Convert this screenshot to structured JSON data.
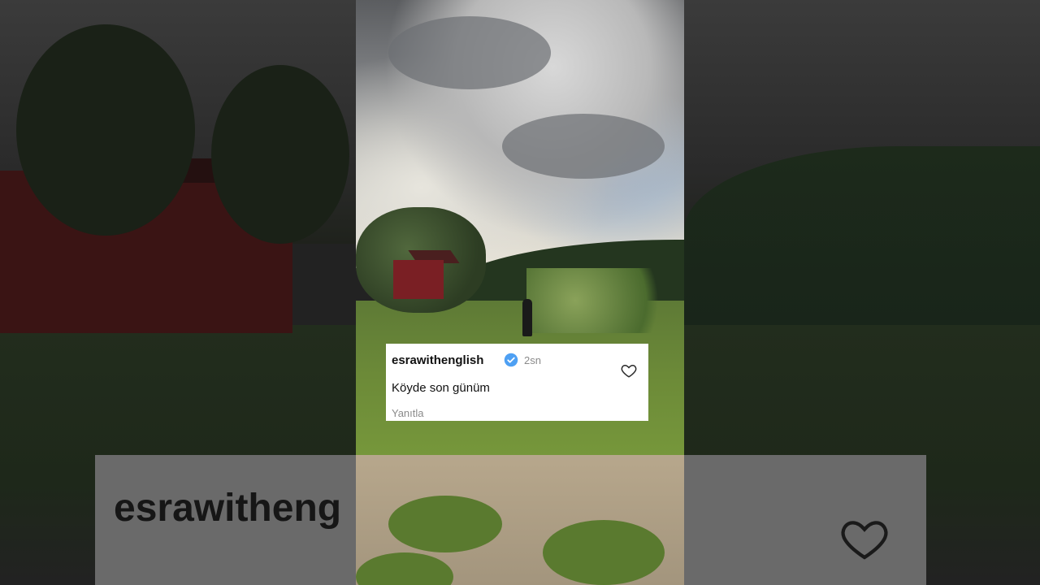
{
  "comment_card": {
    "username": "esrawithenglish",
    "verified_icon": "verified-badge-icon",
    "timestamp": "2sn",
    "text": "Köyde son günüm",
    "reply_label": "Yanıtla",
    "like_icon": "heart-outline-icon"
  },
  "backdrop": {
    "name_text": "esrawitheng",
    "like_icon": "heart-outline-icon"
  },
  "colors": {
    "card_bg": "#ffffff",
    "verified_blue": "#4ea0f3",
    "muted_text": "#8a8a8a"
  }
}
